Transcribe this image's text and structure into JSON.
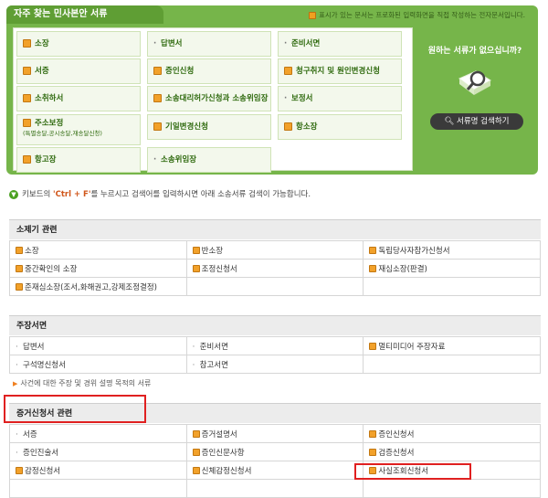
{
  "top": {
    "tab_title": "자주 찾는 민사본안 서류",
    "note": "표시가 있는 문서는 프로화된 입력화면을 직접 작성하는 전자문서입니다.",
    "cells": [
      {
        "label": "소장",
        "icon": "checkbox-icon"
      },
      {
        "label": "답변서",
        "icon": "dot"
      },
      {
        "label": "준비서면",
        "icon": "dot"
      },
      {
        "label": "서증",
        "icon": "checkbox-icon"
      },
      {
        "label": "증인신청",
        "icon": "checkbox-icon"
      },
      {
        "label": "청구취지 및 원인변경신청",
        "icon": "checkbox-icon"
      },
      {
        "label": "소취하서",
        "icon": "checkbox-icon"
      },
      {
        "label": "소송대리허가신청과 소송위임장",
        "icon": "checkbox-icon"
      },
      {
        "label": "보정서",
        "icon": "dot"
      },
      {
        "label": "주소보정",
        "sub": "(특별송달,공시송달,재송달신청)",
        "icon": "checkbox-icon"
      },
      {
        "label": "기일변경신청",
        "icon": "checkbox-icon"
      },
      {
        "label": "항소장",
        "icon": "checkbox-icon"
      },
      {
        "label": "항고장",
        "icon": "checkbox-icon"
      },
      {
        "label": "소송위임장",
        "icon": "dot"
      }
    ],
    "side_title": "원하는 서류가 없으십니까?",
    "search_button": "서류명 검색하기"
  },
  "help": {
    "pre": "키보드의",
    "ctrl": "'Ctrl + F'",
    "post": "를 누르시고 검색어를 입력하시면 아래 소송서류 검색이 가능합니다."
  },
  "sections": [
    {
      "title": "소제기 관련",
      "rows": [
        [
          {
            "t": "소장",
            "c": true
          },
          {
            "t": "반소장",
            "c": true
          },
          {
            "t": "독립당사자참가신청서",
            "c": true
          }
        ],
        [
          {
            "t": "중간확인의 소장",
            "c": true
          },
          {
            "t": "조정신청서",
            "c": true
          },
          {
            "t": "재심소장(판결)",
            "c": true
          }
        ],
        [
          {
            "t": "준재심소장(조서,화해권고,강제조정결정)",
            "c": true
          },
          {
            "t": "",
            "c": false
          },
          {
            "t": "",
            "c": false
          }
        ]
      ]
    },
    {
      "title": "주장서면",
      "rows": [
        [
          {
            "t": "답변서",
            "c": false
          },
          {
            "t": "준비서면",
            "c": false
          },
          {
            "t": "멀티미디어 주장자료",
            "c": true
          }
        ],
        [
          {
            "t": "구석명신청서",
            "c": false
          },
          {
            "t": "참고서면",
            "c": false
          },
          {
            "t": "",
            "c": false
          }
        ]
      ]
    },
    {
      "title": "증거신청서 관련",
      "rows": [
        [
          {
            "t": "서증",
            "c": false
          },
          {
            "t": "증거설명서",
            "c": true
          },
          {
            "t": "증인신청서",
            "c": true
          }
        ],
        [
          {
            "t": "증인진술서",
            "c": false
          },
          {
            "t": "증인신문사항",
            "c": true
          },
          {
            "t": "검증신청서",
            "c": true
          }
        ],
        [
          {
            "t": "감정신청서",
            "c": true
          },
          {
            "t": "신체감정신청서",
            "c": true
          },
          {
            "t": "사실조회신청서",
            "c": true
          }
        ],
        [
          {
            "t": "",
            "c": false
          },
          {
            "t": "",
            "c": false
          },
          {
            "t": "",
            "c": false
          }
        ]
      ]
    }
  ],
  "sub_note": "사건에 대한 주장 및 경위 설명 목적의 서류",
  "colors": {
    "green": "#76b54a",
    "dark_green": "#5f9e34",
    "highlight_red": "#e02020"
  }
}
